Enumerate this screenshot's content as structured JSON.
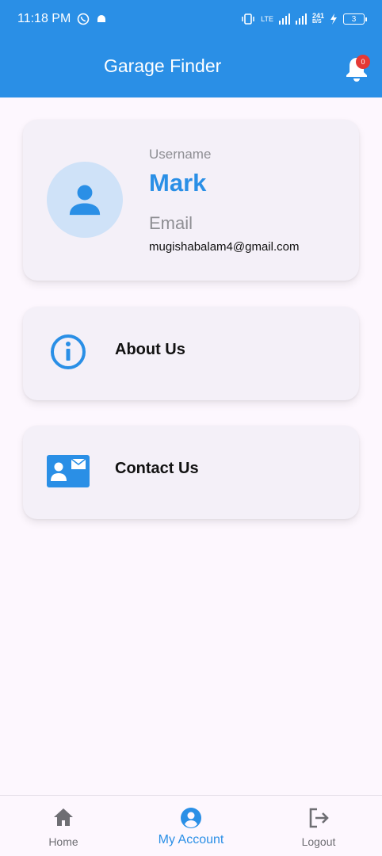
{
  "status_bar": {
    "time": "11:18 PM",
    "network": "LTE",
    "speed_top": "241",
    "speed_bottom": "B/S",
    "battery": "3"
  },
  "app_bar": {
    "title": "Garage Finder",
    "notification_count": "0"
  },
  "profile": {
    "username_label": "Username",
    "username": "Mark",
    "email_label": "Email",
    "email": "mugishabalam4@gmail.com"
  },
  "menu": {
    "about_label": "About Us",
    "contact_label": "Contact Us"
  },
  "bottom_nav": {
    "home_label": "Home",
    "account_label": "My Account",
    "logout_label": "Logout",
    "active": "My Account"
  },
  "colors": {
    "primary": "#2a8fe6",
    "background": "#fdf7fe",
    "card": "#f4f0f8",
    "badge": "#e53935"
  }
}
